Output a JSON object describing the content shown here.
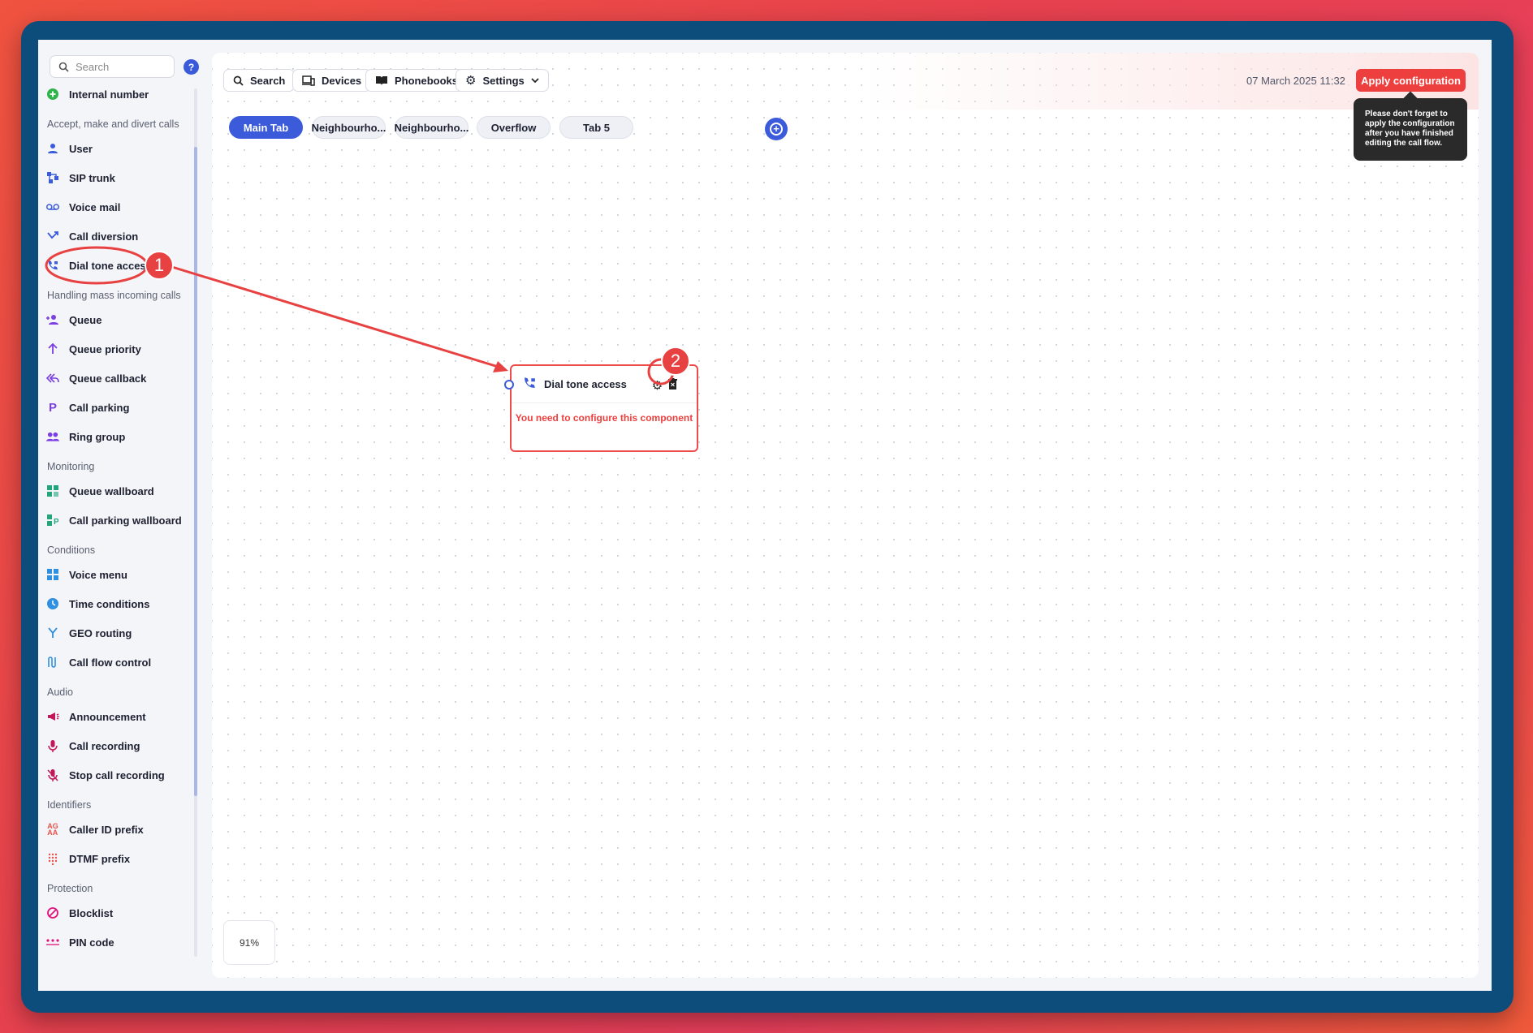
{
  "sidebar": {
    "search_placeholder": "Search",
    "help_label": "?",
    "internal_number": "Internal number",
    "sections": [
      {
        "heading": "Accept, make and divert calls",
        "items": [
          "User",
          "SIP trunk",
          "Voice mail",
          "Call diversion",
          "Dial tone access"
        ]
      },
      {
        "heading": "Handling mass incoming calls",
        "items": [
          "Queue",
          "Queue priority",
          "Queue callback",
          "Call parking",
          "Ring group"
        ]
      },
      {
        "heading": "Monitoring",
        "items": [
          "Queue wallboard",
          "Call parking wallboard"
        ]
      },
      {
        "heading": "Conditions",
        "items": [
          "Voice menu",
          "Time conditions",
          "GEO routing",
          "Call flow control"
        ]
      },
      {
        "heading": "Audio",
        "items": [
          "Announcement",
          "Call recording",
          "Stop call recording"
        ]
      },
      {
        "heading": "Identifiers",
        "items": [
          "Caller ID prefix",
          "DTMF prefix"
        ]
      },
      {
        "heading": "Protection",
        "items": [
          "Blocklist",
          "PIN code"
        ]
      }
    ]
  },
  "toolbar": {
    "search_label": "Search",
    "devices_label": "Devices",
    "phonebooks_label": "Phonebooks",
    "settings_label": "Settings",
    "datetime": "07 March 2025 11:32",
    "apply_label": "Apply configuration",
    "tooltip": "Please don't forget to apply the configuration after you have finished editing the call flow."
  },
  "tabs": [
    "Main Tab",
    "Neighbourho...",
    "Neighbourho...",
    "Overflow",
    "Tab 5"
  ],
  "node": {
    "title": "Dial tone access",
    "message": "You need to configure this component"
  },
  "zoom": "91%",
  "annotations": {
    "step1": "1",
    "step2": "2"
  },
  "colors": {
    "accent": "#3b5bdb",
    "danger": "#ee3f3f",
    "frame": "#0d4d7c"
  }
}
